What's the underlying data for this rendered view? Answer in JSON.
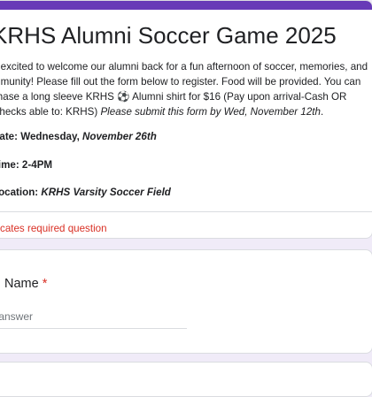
{
  "colors": {
    "accent": "#673ab7",
    "required": "#d93025",
    "background": "#f0ebf8"
  },
  "form": {
    "title": "KRHS Alumni Soccer Game 2025",
    "description_main": "e excited to welcome our alumni back for a fun afternoon of soccer, memories, and mmunity! Please fill out the form below to register. Food will be provided. You can chase a long sleeve KRHS ⚽ Alumni shirt  for $16 (Pay upon arrival-Cash OR Checks able to: KRHS) ",
    "description_italic": "Please submit this form by Wed, November 12th",
    "description_end": ".",
    "date_label": "Date: Wednesday, ",
    "date_value": "November 26th",
    "time_label": "Time: 2-4PM",
    "location_label": "Location: ",
    "location_value": "KRHS Varsity Soccer Field",
    "required_note": "dicates required question"
  },
  "question": {
    "label": " Name",
    "required_mark": "*",
    "placeholder": "r answer"
  }
}
